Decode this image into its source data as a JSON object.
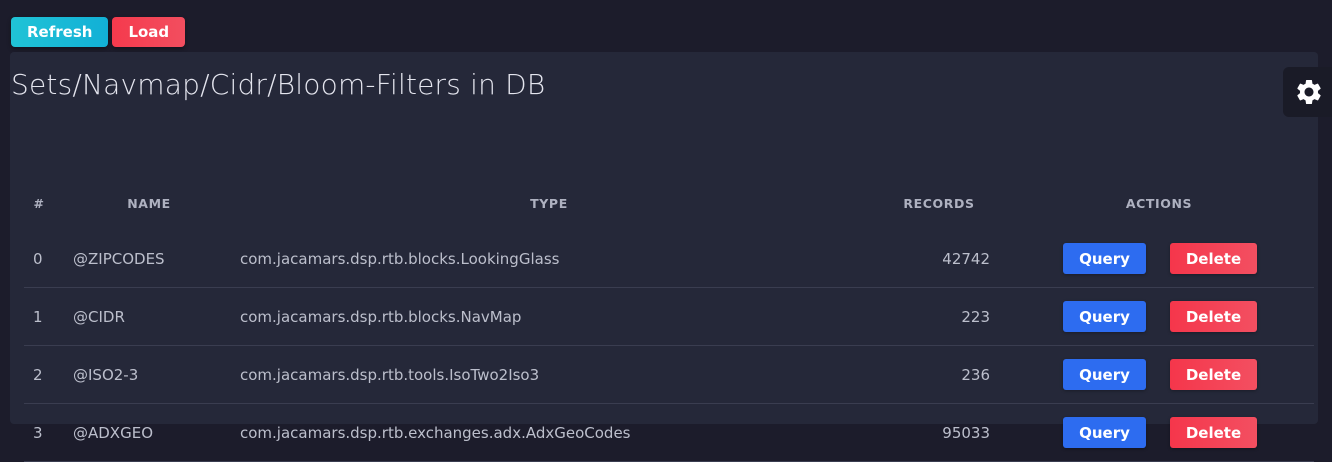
{
  "toolbar": {
    "refresh_label": "Refresh",
    "load_label": "Load"
  },
  "panel": {
    "title": "Sets/Navmap/Cidr/Bloom-Filters in DB"
  },
  "table": {
    "headers": {
      "index": "#",
      "name": "NAME",
      "type": "TYPE",
      "records": "RECORDS",
      "actions": "ACTIONS"
    },
    "rows": [
      {
        "index": "0",
        "name": "@ZIPCODES",
        "type": "com.jacamars.dsp.rtb.blocks.LookingGlass",
        "records": "42742",
        "query_label": "Query",
        "delete_label": "Delete"
      },
      {
        "index": "1",
        "name": "@CIDR",
        "type": "com.jacamars.dsp.rtb.blocks.NavMap",
        "records": "223",
        "query_label": "Query",
        "delete_label": "Delete"
      },
      {
        "index": "2",
        "name": "@ISO2-3",
        "type": "com.jacamars.dsp.rtb.tools.IsoTwo2Iso3",
        "records": "236",
        "query_label": "Query",
        "delete_label": "Delete"
      },
      {
        "index": "3",
        "name": "@ADXGEO",
        "type": "com.jacamars.dsp.rtb.exchanges.adx.AdxGeoCodes",
        "records": "95033",
        "query_label": "Query",
        "delete_label": "Delete"
      }
    ]
  },
  "icons": {
    "settings": "gear-icon"
  },
  "colors": {
    "background": "#1c1c2b",
    "panel": "#252839",
    "refresh": "#17b8d6",
    "danger": "#f5364b",
    "primary": "#2d6cf0"
  }
}
